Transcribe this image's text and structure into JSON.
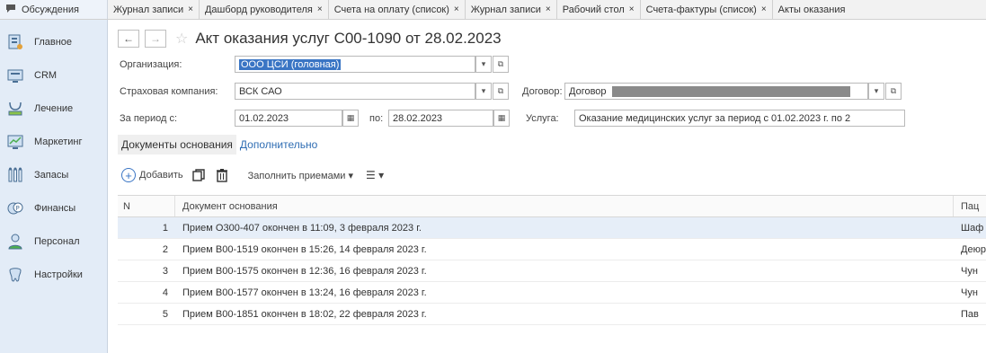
{
  "topbar": {
    "discussions_label": "Обсуждения",
    "tabs": [
      {
        "label": "Журнал записи",
        "close": "×"
      },
      {
        "label": "Дашборд руководителя",
        "close": "×"
      },
      {
        "label": "Счета на оплату (список)",
        "close": "×"
      },
      {
        "label": "Журнал записи",
        "close": "×"
      },
      {
        "label": "Рабочий стол",
        "close": "×"
      },
      {
        "label": "Счета-фактуры (список)",
        "close": "×"
      },
      {
        "label": "Акты оказания",
        "close": ""
      }
    ]
  },
  "sidebar": {
    "items": [
      {
        "label": "Главное",
        "icon": "home-icon"
      },
      {
        "label": "CRM",
        "icon": "crm-icon"
      },
      {
        "label": "Лечение",
        "icon": "treatment-icon"
      },
      {
        "label": "Маркетинг",
        "icon": "marketing-icon"
      },
      {
        "label": "Запасы",
        "icon": "inventory-icon"
      },
      {
        "label": "Финансы",
        "icon": "finance-icon"
      },
      {
        "label": "Персонал",
        "icon": "staff-icon"
      },
      {
        "label": "Настройки",
        "icon": "settings-icon"
      }
    ]
  },
  "header": {
    "back": "←",
    "forward": "→",
    "star": "☆",
    "title": "Акт оказания услуг С00-1090 от 28.02.2023"
  },
  "form": {
    "org_label": "Организация:",
    "org_value": "ООО ЦСИ (головная)",
    "insurer_label": "Страховая компания:",
    "insurer_value": "ВСК САО",
    "contract_label": "Договор:",
    "contract_value": "Договор",
    "period_label": "За период с:",
    "period_from": "01.02.2023",
    "period_to_label": "по:",
    "period_to": "28.02.2023",
    "service_label": "Услуга:",
    "service_value": "Оказание медицинских услуг за период с 01.02.2023 г. по 2"
  },
  "subtabs": {
    "active": "Документы основания",
    "other": "Дополнительно"
  },
  "toolbar": {
    "add_label": "Добавить",
    "fill_label": "Заполнить приемами ▾",
    "more_label": "☰ ▾"
  },
  "table": {
    "columns": [
      "N",
      "Документ основания",
      "Пац"
    ],
    "rows": [
      {
        "n": "1",
        "doc": "Прием О300-407 окончен в 11:09, 3 февраля 2023 г.",
        "patient": "Шаф"
      },
      {
        "n": "2",
        "doc": "Прием В00-1519 окончен в 15:26, 14 февраля 2023 г.",
        "patient": "Деюр"
      },
      {
        "n": "3",
        "doc": "Прием В00-1575 окончен в 12:36, 16 февраля 2023 г.",
        "patient": "Чун"
      },
      {
        "n": "4",
        "doc": "Прием В00-1577 окончен в 13:24, 16 февраля 2023 г.",
        "patient": "Чун"
      },
      {
        "n": "5",
        "doc": "Прием В00-1851 окончен в 18:02, 22 февраля 2023 г.",
        "patient": "Пав"
      }
    ],
    "selected_row": 1
  },
  "colors": {
    "accent": "#3a75c4",
    "sidebar_bg": "#e3ecf7",
    "selected_row_bg": "#e6eef8",
    "link": "#2f6db3"
  }
}
